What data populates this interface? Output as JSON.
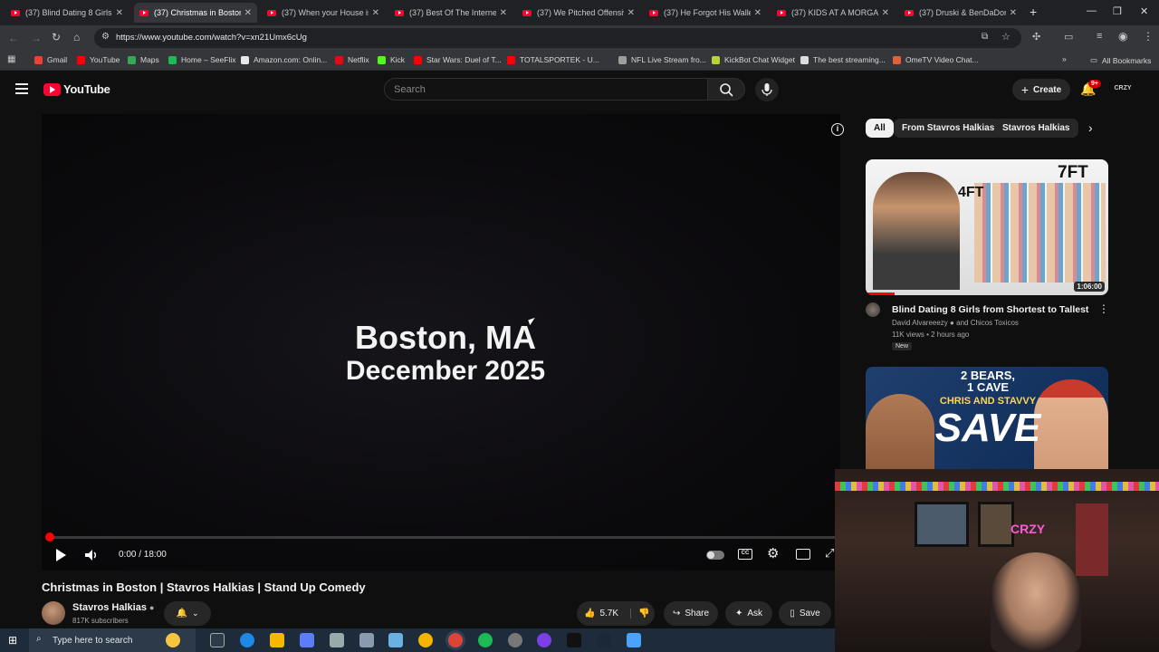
{
  "browser": {
    "tabs": [
      {
        "title": "(37) Blind Dating 8 Girls fr",
        "active": false
      },
      {
        "title": "(37) Christmas in Boston |",
        "active": true
      },
      {
        "title": "(37) When your House is I",
        "active": false
      },
      {
        "title": "(37) Best Of The Internet (",
        "active": false
      },
      {
        "title": "(37) We Pitched Offensive",
        "active": false
      },
      {
        "title": "(37) He Forgot His Wallet.",
        "active": false
      },
      {
        "title": "(37) KIDS AT A MORGAN",
        "active": false
      },
      {
        "title": "(37) Druski & BenDaDonn",
        "active": false
      }
    ],
    "new_tab": "+",
    "url": "https://www.youtube.com/watch?v=xn21Umx6cUg",
    "bookmarks": [
      {
        "label": "Gmail",
        "color": "#ea4335"
      },
      {
        "label": "YouTube",
        "color": "#ff0000"
      },
      {
        "label": "Maps",
        "color": "#34a853"
      },
      {
        "label": "Home – SeeFlix",
        "color": "#1db954"
      },
      {
        "label": "Amazon.com: Onlin...",
        "color": "#e8e8e8"
      },
      {
        "label": "Netflix",
        "color": "#e50914"
      },
      {
        "label": "Kick",
        "color": "#53fc18"
      },
      {
        "label": "Star Wars: Duel of T...",
        "color": "#ff0000"
      },
      {
        "label": "TOTALSPORTEK - U...",
        "color": "#ff0000"
      },
      {
        "label": "NFL Live Stream fro...",
        "color": "#9e9e9e"
      },
      {
        "label": "KickBot Chat Widget",
        "color": "#b5d334"
      },
      {
        "label": "The best streaming...",
        "color": "#dddddd"
      },
      {
        "label": "OmeTV Video Chat...",
        "color": "#e0603a"
      }
    ],
    "all_bookmarks": "All Bookmarks"
  },
  "youtube": {
    "logo_text": "YouTube",
    "search_placeholder": "Search",
    "create_label": "Create",
    "notif_badge": "9+",
    "avatar_text": "CRZY"
  },
  "player": {
    "overlay_line1": "Boston, MA",
    "overlay_line2": "December 2025",
    "time": "0:00 / 18:00",
    "progress_fraction": 0.0
  },
  "video": {
    "title": "Christmas in Boston | Stavros Halkias | Stand Up Comedy",
    "channel": "Stavros Halkias",
    "subscribers": "817K subscribers",
    "likes": "5.7K",
    "share": "Share",
    "ask": "Ask",
    "save": "Save"
  },
  "sidebar": {
    "chips": [
      "All",
      "From Stavros Halkias",
      "Stavros Halkias"
    ],
    "videos": [
      {
        "title": "Blind Dating 8 Girls from Shortest to Tallest",
        "channel": "David Alvareeezy",
        "collab": "and Chicos Toxicos",
        "meta": "11K views • 2 hours ago",
        "badge": "New",
        "duration": "1:06:00",
        "thumb_text_left": "4FT",
        "thumb_text_right": "7FT"
      },
      {
        "thumb_line1": "2 BEARS,",
        "thumb_line2": "1 CAVE",
        "thumb_line3": "CHRIS AND STAVVY",
        "thumb_line4": "SAVE"
      }
    ]
  },
  "webcam": {
    "sign": "CRZY"
  },
  "taskbar": {
    "search_placeholder": "Type here to search"
  }
}
